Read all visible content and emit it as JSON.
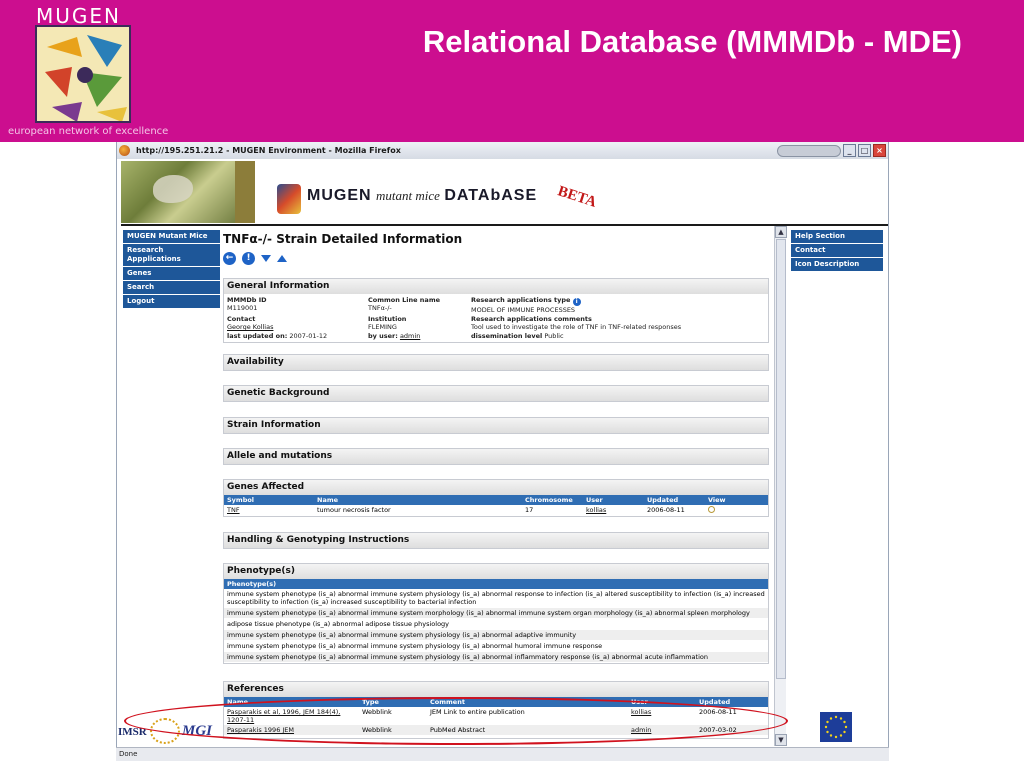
{
  "slide": {
    "logo_text": "MUGEN",
    "tagline": "european network of excellence",
    "title": "Relational Database (MMMDb - MDE)"
  },
  "browser": {
    "window_title": "http://195.251.21.2 - MUGEN Environment - Mozilla Firefox",
    "status_text": "Done"
  },
  "site": {
    "logo_bold": "MUGEN",
    "logo_italic": "mutant mice",
    "logo_bold2": "DATAbASE",
    "beta": "BETA"
  },
  "left_nav": [
    {
      "label": "MUGEN Mutant Mice"
    },
    {
      "label": "Research Appplications"
    },
    {
      "label": "Genes"
    },
    {
      "label": "Search"
    },
    {
      "label": "Logout"
    }
  ],
  "right_nav": [
    {
      "label": "Help Section"
    },
    {
      "label": "Contact"
    },
    {
      "label": "Icon Description"
    }
  ],
  "page": {
    "heading": "TNFα-/- Strain Detailed Information"
  },
  "general_info": {
    "title": "General Information",
    "mmmdb_id_label": "MMMDb ID",
    "mmmdb_id": "M119001",
    "common_line_label": "Common Line name",
    "common_line": "TNFα-/-",
    "research_type_label": "Research applications type",
    "research_type": "MODEL OF IMMUNE PROCESSES",
    "contact_label": "Contact",
    "contact": "George Kollias",
    "institution_label": "Institution",
    "institution": "FLEMING",
    "research_comments_label": "Research applications comments",
    "research_comments": "Tool used to investigate the role of TNF in TNF-related responses",
    "last_updated_label": "last updated on:",
    "last_updated": "2007-01-12",
    "by_user_label": "by user:",
    "by_user": "admin",
    "dissemination_label": "dissemination level",
    "dissemination": "Public"
  },
  "sections": {
    "availability": "Availability",
    "genetic_background": "Genetic Background",
    "strain_information": "Strain Information",
    "allele_mutations": "Allele and mutations",
    "genes_affected": "Genes Affected",
    "handling": "Handling & Genotyping Instructions",
    "phenotypes": "Phenotype(s)",
    "references": "References"
  },
  "genes_table": {
    "headers": [
      "Symbol",
      "Name",
      "Chromosome",
      "User",
      "Updated",
      "View"
    ],
    "rows": [
      {
        "symbol": "TNF",
        "name": "tumour necrosis factor",
        "chromosome": "17",
        "user": "kollias",
        "updated": "2006-08-11"
      }
    ]
  },
  "phenotypes": {
    "header": "Phenotype(s)",
    "rows": [
      "immune system phenotype (is_a) abnormal immune system physiology (is_a) abnormal response to infection (is_a) altered susceptibility to infection (is_a) increased susceptibility to infection (is_a) increased susceptibility to bacterial infection",
      "immune system phenotype (is_a) abnormal immune system morphology (is_a) abnormal immune system organ morphology (is_a) abnormal spleen morphology",
      "adipose tissue phenotype (is_a) abnormal adipose tissue physiology",
      "immune system phenotype (is_a) abnormal immune system physiology (is_a) abnormal adaptive immunity",
      "immune system phenotype (is_a) abnormal immune system physiology (is_a) abnormal humoral immune response",
      "immune system phenotype (is_a) abnormal immune system physiology (is_a) abnormal inflammatory response (is_a) abnormal acute inflammation"
    ]
  },
  "references_table": {
    "headers": [
      "Name",
      "Type",
      "Comment",
      "User",
      "Updated"
    ],
    "rows": [
      {
        "name": "Pasparakis et al, 1996, JEM 184(4), 1207-11",
        "type": "Webblink",
        "comment": "JEM Link to entire publication",
        "user": "kollias",
        "updated": "2006-08-11"
      },
      {
        "name": "Pasparakis 1996 JEM",
        "type": "Webblink",
        "comment": "PubMed Abstract",
        "user": "admin",
        "updated": "2007-03-02"
      }
    ]
  },
  "footer_logos": {
    "imsr": "IMSR",
    "mgi": "MGI"
  },
  "colors": {
    "slide_header": "#cc0e8f",
    "nav_blue": "#1e5799",
    "table_header_blue": "#2f6db3",
    "highlight_red": "#d0121e"
  }
}
